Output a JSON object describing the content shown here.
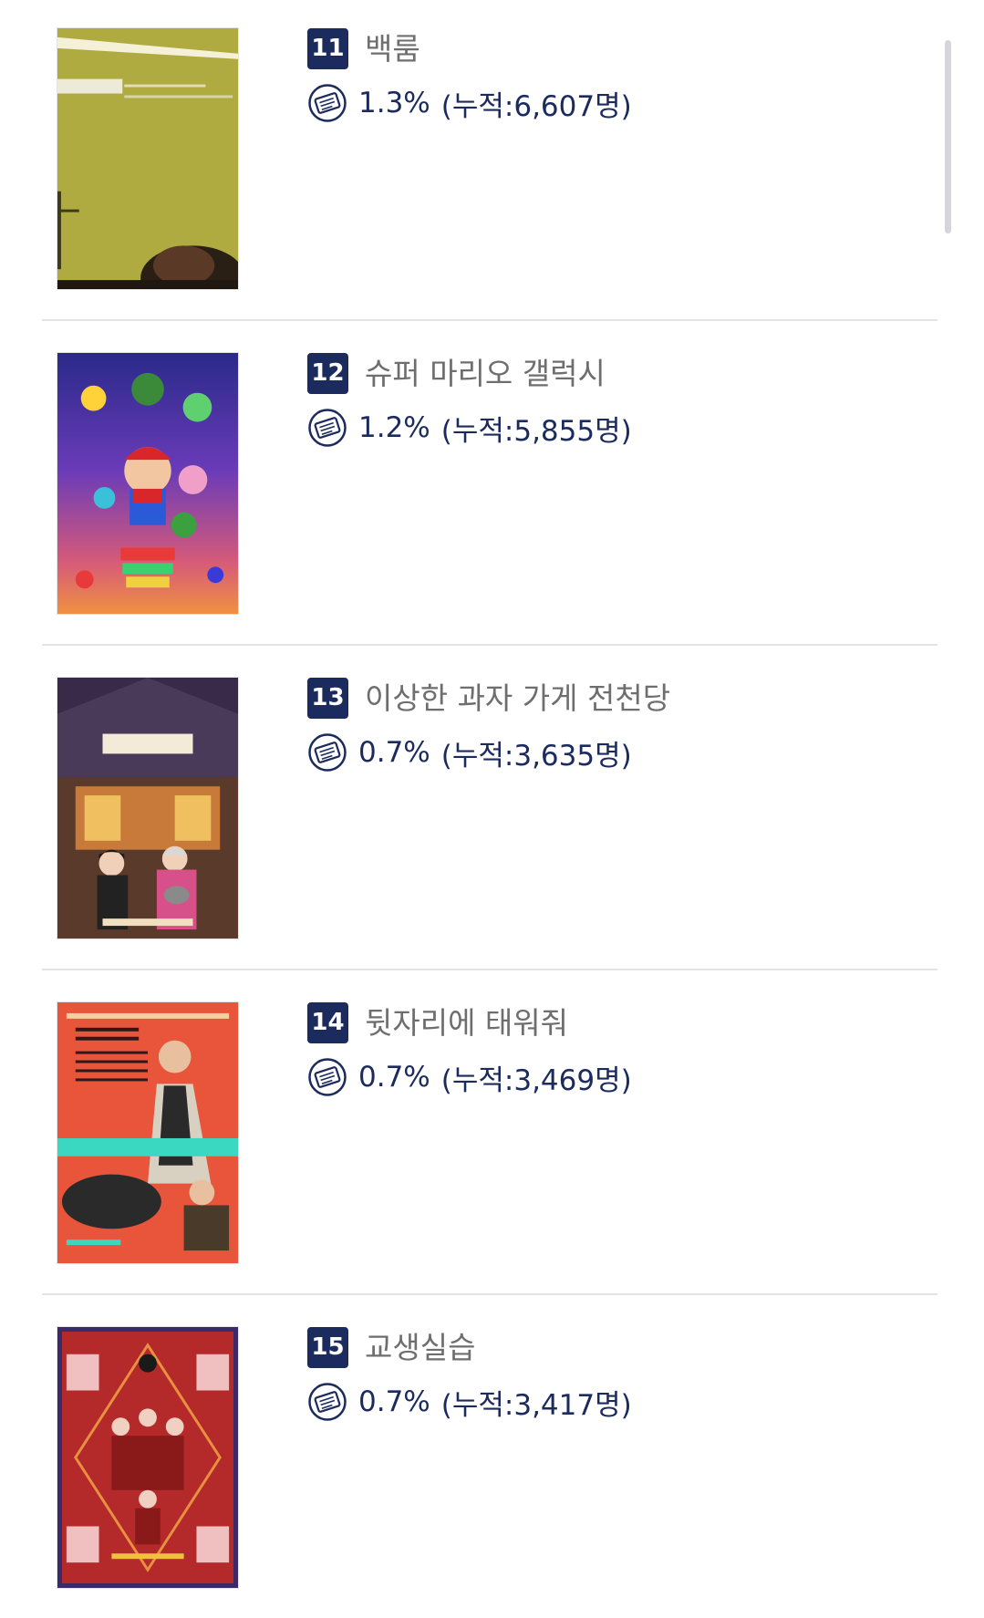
{
  "colors": {
    "badge_bg": "#1c2b5e",
    "stats_text": "#1c2b5e",
    "title_text": "#6e6e6e",
    "divider": "#e3e3e3"
  },
  "movies": [
    {
      "rank": "11",
      "title": "백룸",
      "share": "1.3%",
      "cumulative": "(누적:6,607명)"
    },
    {
      "rank": "12",
      "title": "슈퍼 마리오 갤럭시",
      "share": "1.2%",
      "cumulative": "(누적:5,855명)"
    },
    {
      "rank": "13",
      "title": "이상한 과자 가게 전천당",
      "share": "0.7%",
      "cumulative": "(누적:3,635명)"
    },
    {
      "rank": "14",
      "title": "뒷자리에 태워줘",
      "share": "0.7%",
      "cumulative": "(누적:3,469명)"
    },
    {
      "rank": "15",
      "title": "교생실습",
      "share": "0.7%",
      "cumulative": "(누적:3,417명)"
    }
  ],
  "icons": {
    "ticket": "ticket-icon"
  }
}
